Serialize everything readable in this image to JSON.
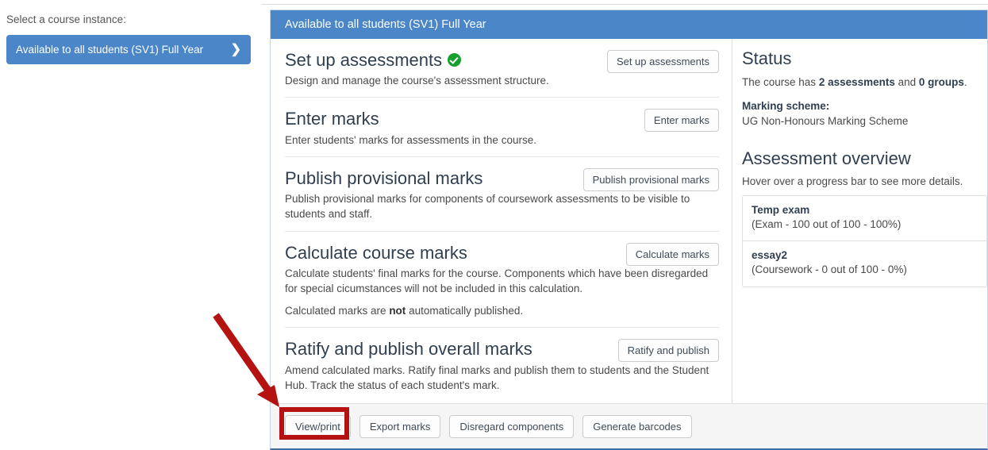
{
  "sidebar": {
    "label": "Select a course instance:",
    "course_button": "Available to all students (SV1) Full Year",
    "chevron": "❯"
  },
  "panel": {
    "header_title": "Available to all students (SV1) Full Year",
    "steps": [
      {
        "title": "Set up assessments",
        "has_check": true,
        "desc": "Design and manage the course's assessment structure.",
        "button": "Set up assessments"
      },
      {
        "title": "Enter marks",
        "has_check": false,
        "desc": "Enter students' marks for assessments in the course.",
        "button": "Enter marks"
      },
      {
        "title": "Publish provisional marks",
        "has_check": false,
        "desc": "Publish provisional marks for components of coursework assessments to be visible to students and staff.",
        "button": "Publish provisional marks"
      },
      {
        "title": "Calculate course marks",
        "has_check": false,
        "desc": "Calculate students' final marks for the course. Components which have been disregarded for special cicumstances will not be included in this calculation.",
        "desc2_pre": "Calculated marks are ",
        "desc2_bold": "not",
        "desc2_post": " automatically published.",
        "button": "Calculate marks"
      },
      {
        "title": "Ratify and publish overall marks",
        "has_check": false,
        "desc": "Amend calculated marks. Ratify final marks and publish them to students and the Student Hub. Track the status of each student's mark.",
        "button": "Ratify and publish"
      }
    ],
    "footer_buttons": [
      "View/print",
      "Export marks",
      "Disregard components",
      "Generate barcodes"
    ]
  },
  "status": {
    "heading": "Status",
    "course_line_pre": "The course has ",
    "assessments_count": "2 assessments",
    "course_line_mid": " and ",
    "groups_count": "0 groups",
    "course_line_post": ".",
    "marking_scheme_label": "Marking scheme:",
    "marking_scheme_value": "UG Non-Honours Marking Scheme",
    "overview_heading": "Assessment overview",
    "overview_note": "Hover over a progress bar to see more details.",
    "assessments": [
      {
        "name": "Temp exam",
        "meta": "(Exam - 100 out of 100 - 100%)"
      },
      {
        "name": "essay2",
        "meta": "(Coursework - 0 out of 100 - 0%)"
      }
    ]
  },
  "annotations": {
    "highlight_color": "#b51212",
    "arrow_color": "#b51212",
    "highlight_target": "View/print"
  }
}
